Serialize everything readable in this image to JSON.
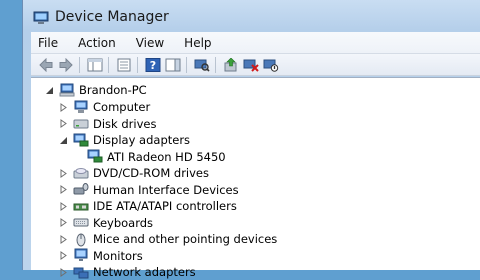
{
  "window": {
    "title": "Device Manager"
  },
  "menu": {
    "items": [
      "File",
      "Action",
      "View",
      "Help"
    ]
  },
  "toolbar": {
    "buttons": [
      "back-icon",
      "forward-icon",
      "show-hide-icon",
      "properties-icon",
      "help-icon",
      "action-pane-icon",
      "scan-hardware-icon",
      "update-driver-icon",
      "uninstall-icon",
      "disable-icon"
    ]
  },
  "tree": {
    "root": "Brandon-PC",
    "items": [
      {
        "label": "Computer",
        "expanded": false
      },
      {
        "label": "Disk drives",
        "expanded": false
      },
      {
        "label": "Display adapters",
        "expanded": true
      },
      {
        "label": "ATI Radeon HD 5450",
        "child": true
      },
      {
        "label": "DVD/CD-ROM drives",
        "expanded": false
      },
      {
        "label": "Human Interface Devices",
        "expanded": false
      },
      {
        "label": "IDE ATA/ATAPI controllers",
        "expanded": false
      },
      {
        "label": "Keyboards",
        "expanded": false
      },
      {
        "label": "Mice and other pointing devices",
        "expanded": false
      },
      {
        "label": "Monitors",
        "expanded": false
      },
      {
        "label": "Network adapters",
        "expanded": false
      }
    ]
  },
  "colors": {
    "desktop": "#5f9fd0",
    "frame": "#bcd4ec"
  }
}
